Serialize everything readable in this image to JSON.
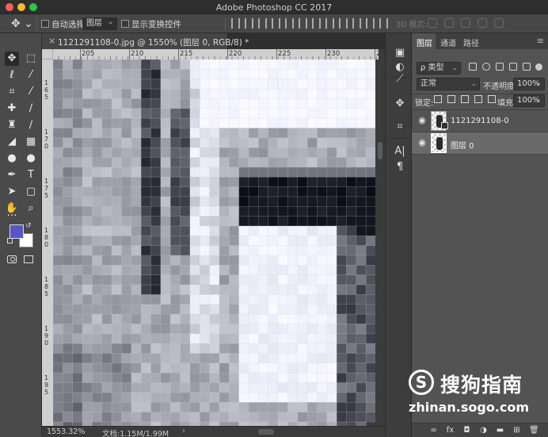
{
  "window": {
    "title": "Adobe Photoshop CC 2017"
  },
  "options_bar": {
    "move_tool_icon": "move-icon",
    "auto_select_label": "自动选择:",
    "auto_select_target": "图层",
    "show_transform_label": "显示变换控件",
    "mode_3d_label": "3D 模式:"
  },
  "document": {
    "tab_title": "1121291108-0.jpg @ 1550% (图层 0, RGB/8) *",
    "ruler_top_labels": [
      "205",
      "210",
      "215",
      "220",
      "225",
      "230",
      "235"
    ],
    "ruler_left_labels": [
      "1 6 5",
      "1 7 0",
      "1 7 5",
      "1 8 0",
      "1 8 5",
      "1 9 0",
      "1 9 5"
    ]
  },
  "status_bar": {
    "zoom": "1553.32%",
    "doc_info": "文档:1.15M/1.99M",
    "arrow": "›"
  },
  "layers_panel": {
    "tabs": [
      "图层",
      "通道",
      "路径"
    ],
    "active_tab": "图层",
    "filter_kind": "ρ 类型",
    "blend_mode": "正常",
    "opacity_label": "不透明度:",
    "opacity_value": "100%",
    "lock_label": "锁定:",
    "fill_label": "填充:",
    "fill_value": "100%",
    "layers": [
      {
        "name": "1121291108-0",
        "visible": true,
        "selected": false
      },
      {
        "name": "图层 0",
        "visible": true,
        "selected": true
      }
    ],
    "bottom_icons": [
      "link-icon",
      "fx-icon",
      "mask-icon",
      "adjustment-icon",
      "group-icon",
      "new-layer-icon",
      "trash-icon"
    ],
    "fx_label": "fx"
  },
  "watermark": {
    "logo_letter": "S",
    "name": "搜狗指南",
    "url": "zhinan.sogo.com"
  },
  "colors": {
    "foreground": "#5656c6",
    "background": "#ffffff"
  }
}
